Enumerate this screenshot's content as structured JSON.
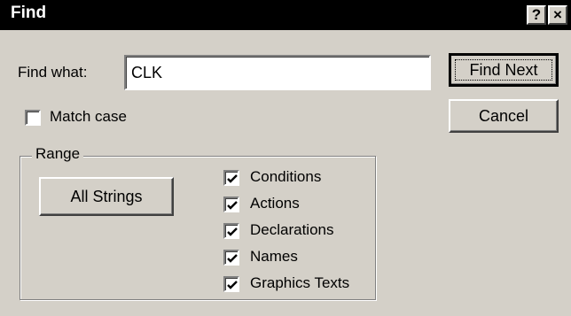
{
  "window": {
    "title": "Find",
    "help_label": "?",
    "close_label": "×"
  },
  "find_what": {
    "label": "Find what:",
    "value": "CLK"
  },
  "buttons": {
    "find_next": "Find Next",
    "cancel": "Cancel",
    "all_strings": "All Strings"
  },
  "match_case": {
    "label": "Match case",
    "checked": false
  },
  "range": {
    "legend": "Range",
    "options": [
      {
        "label": "Conditions",
        "checked": true
      },
      {
        "label": "Actions",
        "checked": true
      },
      {
        "label": "Declarations",
        "checked": true
      },
      {
        "label": "Names",
        "checked": true
      },
      {
        "label": "Graphics Texts",
        "checked": true
      }
    ]
  }
}
